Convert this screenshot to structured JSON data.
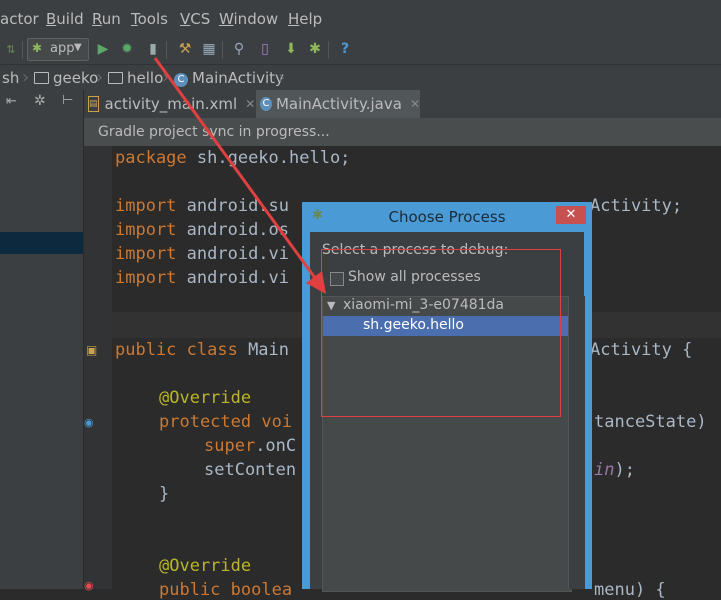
{
  "menu": [
    {
      "label": "actor"
    },
    {
      "label": "Build",
      "mnemonic": "B",
      "rest": "uild"
    },
    {
      "label": "Run",
      "mnemonic": "R",
      "rest": "un"
    },
    {
      "label": "Tools",
      "mnemonic": "T",
      "rest": "ools"
    },
    {
      "label": "VCS",
      "mnemonic": "V",
      "rest": "CS"
    },
    {
      "label": "Window",
      "mnemonic": "W",
      "rest": "indow"
    },
    {
      "label": "Help",
      "mnemonic": "H",
      "rest": "elp"
    }
  ],
  "toolbar": {
    "run_config_label": "app",
    "help_label": "?"
  },
  "breadcrumb": {
    "items": [
      "sh",
      "geeko",
      "hello",
      "MainActivity"
    ]
  },
  "tabs": [
    {
      "label": "activity_main.xml"
    },
    {
      "label": "MainActivity.java"
    }
  ],
  "notification": "Gradle project sync in progress...",
  "code_lines": {
    "l1a": "package ",
    "l1b": "sh.geeko.hello;",
    "l2a": "import ",
    "l2b": "android.su",
    "l2c": "Activity;",
    "l3a": "import ",
    "l3b": "android.os",
    "l4a": "import ",
    "l4b": "android.vi",
    "l5a": "import ",
    "l5b": "android.vi",
    "l6a": "public class ",
    "l6b": "Main",
    "l6c": "Activity {",
    "l7": "@Override",
    "l8a": "protected ",
    "l8b": "voi",
    "l8c": "tanceState)",
    "l9a": "super",
    "l9b": ".onC",
    "l10a": "setConten",
    "l10b": "in",
    "l10c": ");",
    "l11": "}",
    "l12": "@Override",
    "l13a": "public boolea",
    "l13b": "menu) {"
  },
  "dialog": {
    "title": "Choose Process",
    "close": "✕",
    "prompt": "Select a process to debug:",
    "show_all_label": "Show all processes",
    "show_all_checked": false,
    "device": "xiaomi-mi_3-e07481da",
    "process": "sh.geeko.hello"
  },
  "colors": {
    "accent": "#4a9bd5",
    "selection": "#4b6eaf",
    "annotation_red": "#e04040"
  }
}
